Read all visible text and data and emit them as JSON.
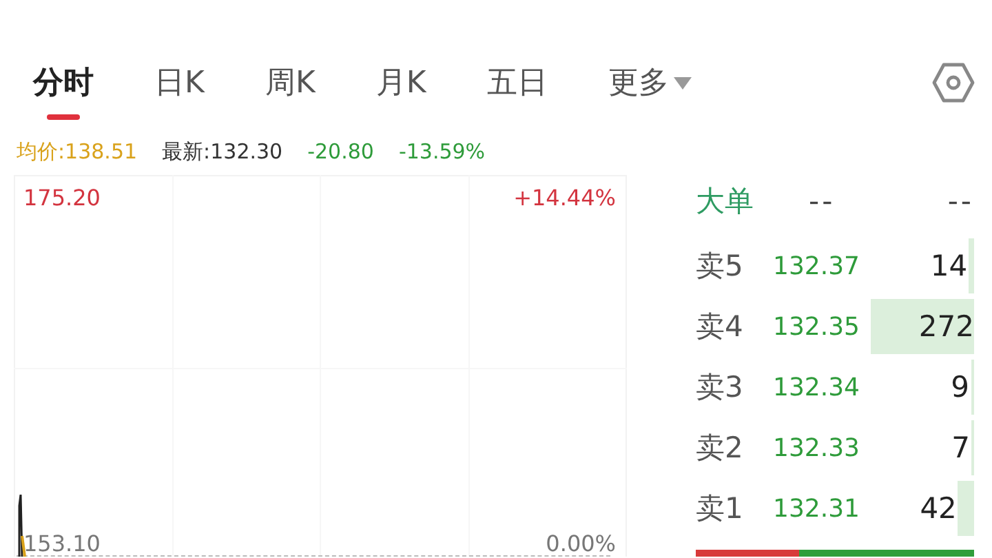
{
  "tabs": [
    {
      "label": "分时",
      "selected": true
    },
    {
      "label": "日K",
      "selected": false
    },
    {
      "label": "周K",
      "selected": false
    },
    {
      "label": "月K",
      "selected": false
    },
    {
      "label": "五日",
      "selected": false
    },
    {
      "label": "更多",
      "selected": false,
      "dropdown": true
    }
  ],
  "quote": {
    "avg_label": "均价:",
    "avg": "138.51",
    "latest_label": "最新:",
    "latest": "132.30",
    "change": "-20.80",
    "change_pct": "-13.59%"
  },
  "chart": {
    "high": "175.20",
    "high_pct": "+14.44%",
    "base": "153.10",
    "base_pct": "0.00%"
  },
  "order_book": {
    "title": "大单",
    "col_2": "--",
    "col_3": "--",
    "sells": [
      {
        "label": "卖5",
        "price": "132.37",
        "volume": "14"
      },
      {
        "label": "卖4",
        "price": "132.35",
        "volume": "272"
      },
      {
        "label": "卖3",
        "price": "132.34",
        "volume": "9"
      },
      {
        "label": "卖2",
        "price": "132.33",
        "volume": "7"
      },
      {
        "label": "卖1",
        "price": "132.31",
        "volume": "42"
      }
    ],
    "buy_sell_bar": {
      "level": 0.37
    }
  }
}
